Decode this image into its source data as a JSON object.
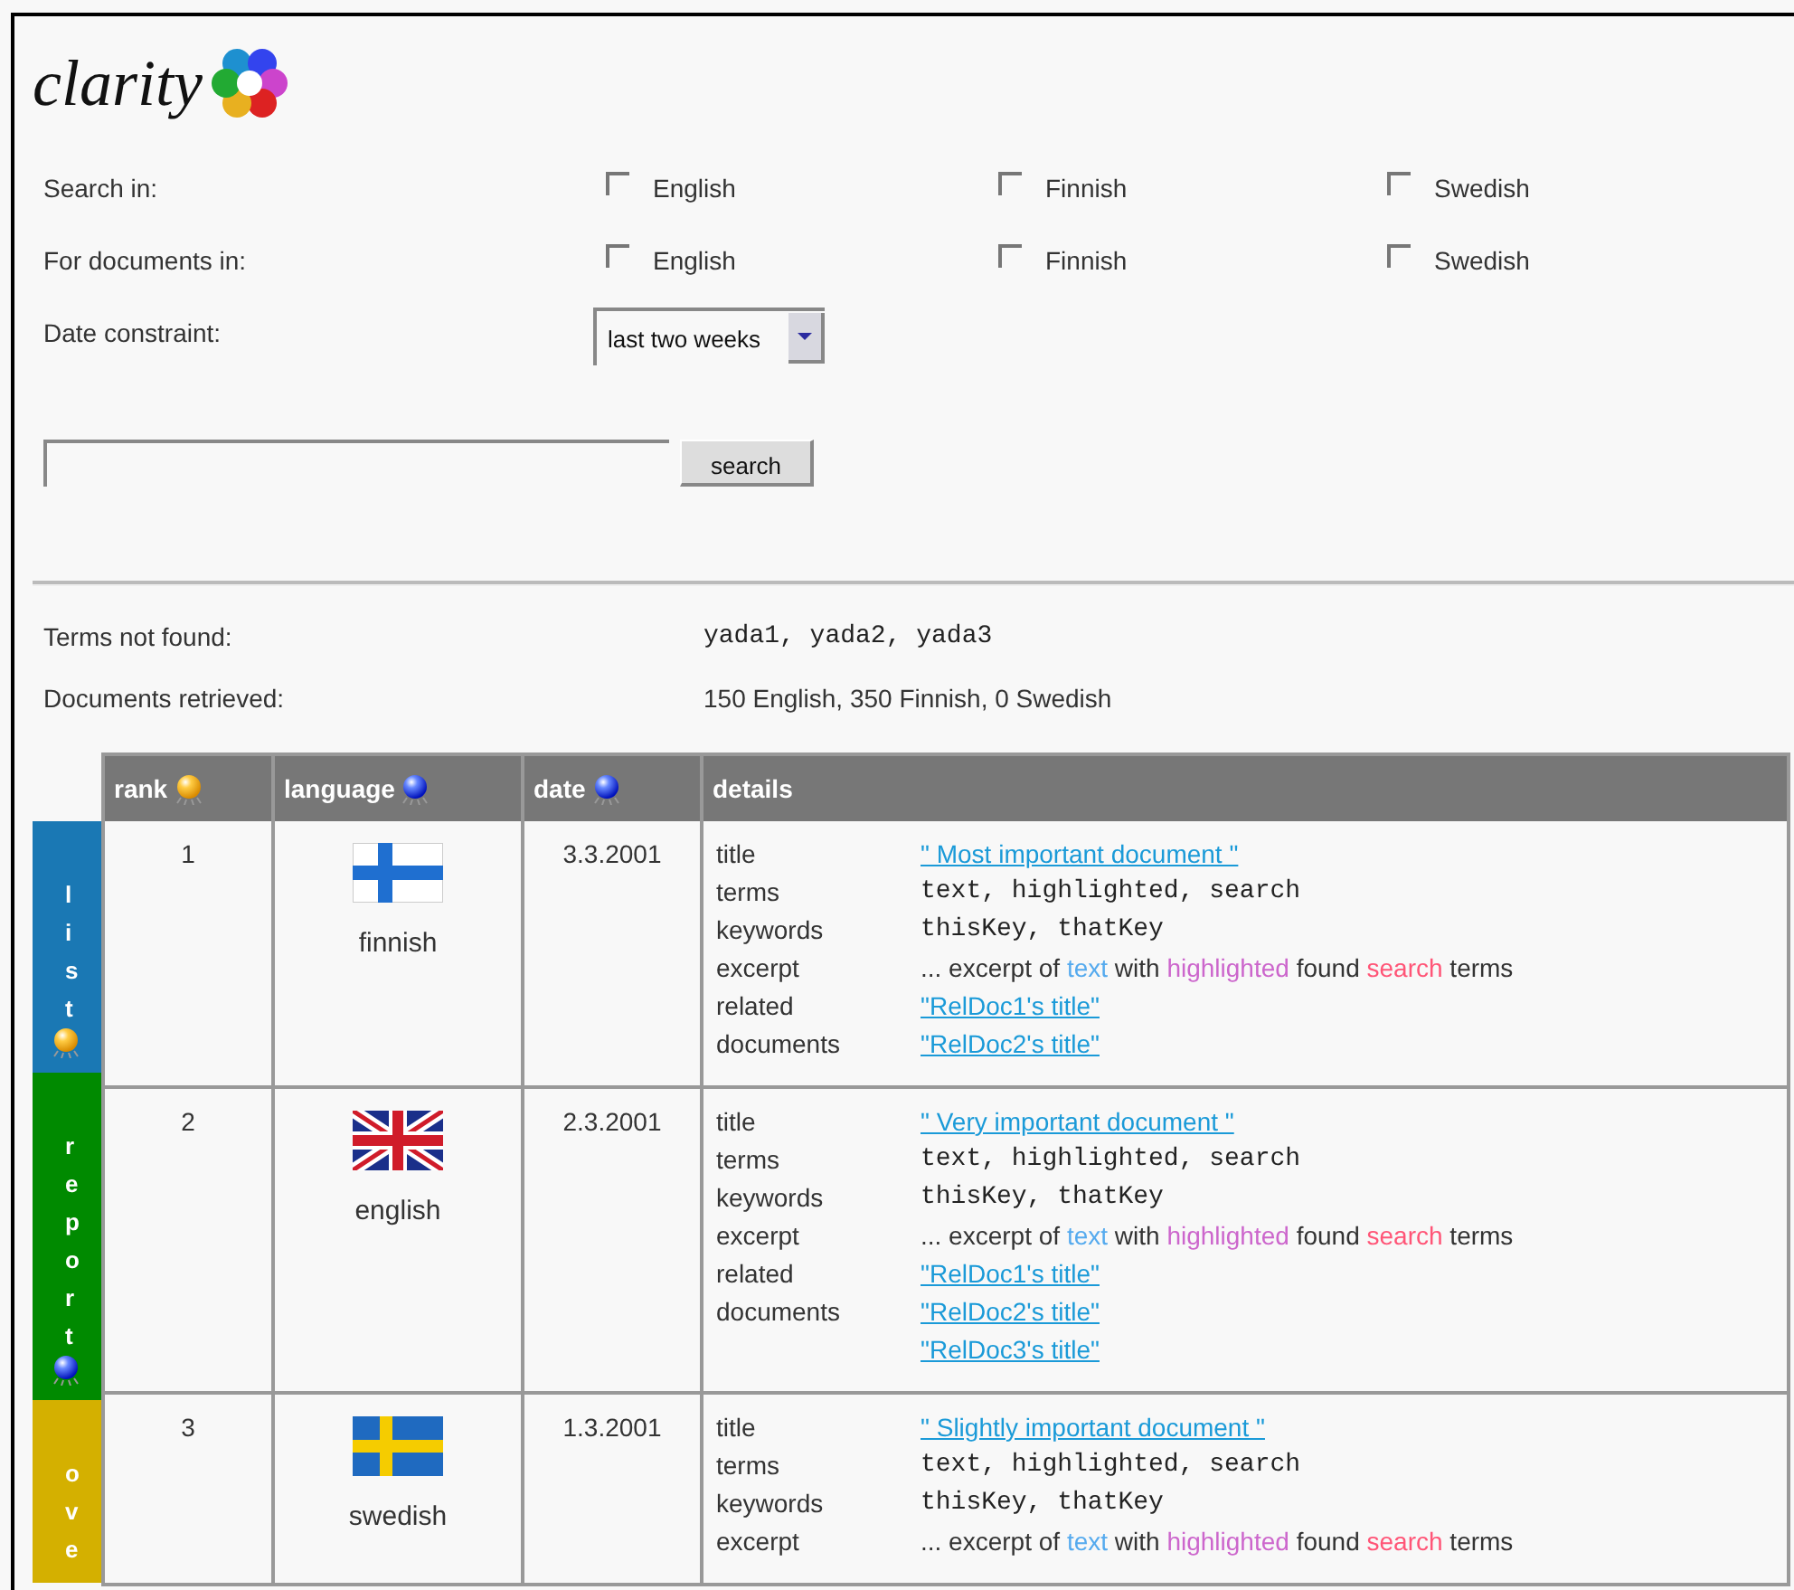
{
  "logo": {
    "text": "clarity"
  },
  "search_in": {
    "label": "Search in:",
    "options": [
      {
        "label": "English",
        "checked": false
      },
      {
        "label": "Finnish",
        "checked": false
      },
      {
        "label": "Swedish",
        "checked": false
      }
    ]
  },
  "documents_in": {
    "label": "For documents in:",
    "options": [
      {
        "label": "English",
        "checked": false
      },
      {
        "label": "Finnish",
        "checked": false
      },
      {
        "label": "Swedish",
        "checked": false
      }
    ]
  },
  "date_constraint": {
    "label": "Date constraint:",
    "value": "last two weeks"
  },
  "query": {
    "button": "search"
  },
  "summary": [
    {
      "label": "Terms not found:",
      "value": "yada1, yada2, yada3",
      "kind": "mono"
    },
    {
      "label": "Documents retrieved:",
      "value": "150 English, 350 Finnish, 0 Swedish",
      "kind": "plain"
    }
  ],
  "view_tabs": [
    {
      "label": "list",
      "color": "#1a78b4",
      "active": true
    },
    {
      "label": "report",
      "color": "#008a00",
      "active": false
    },
    {
      "label": "ove",
      "color": "#d4b000"
    }
  ],
  "table": {
    "columns": [
      {
        "label": "rank",
        "active": true
      },
      {
        "label": "language",
        "active": false
      },
      {
        "label": "date",
        "active": false
      },
      {
        "label": "details"
      }
    ],
    "rows": [
      {
        "rank": "1",
        "kind": "finland",
        "language": "finnish",
        "date": "3.3.2001",
        "details": [
          {
            "label": "title",
            "kind": "link",
            "value": "\" Most important document \""
          },
          {
            "label": "terms",
            "kind": "mono",
            "value": "text, highlighted, search"
          },
          {
            "label": "keywords",
            "kind": "mono",
            "value": "thisKey, thatKey"
          },
          {
            "label": "excerpt",
            "kind": "excerpt",
            "parts": [
              {
                "text": "... excerpt of "
              },
              {
                "text": "text",
                "color": "#55aaee"
              },
              {
                "text": " with "
              },
              {
                "text": "highlighted",
                "color": "#cc66cc"
              },
              {
                "text": " found "
              },
              {
                "text": "search",
                "color": "#ff5577"
              },
              {
                "text": " terms"
              }
            ]
          },
          {
            "label": "related documents",
            "kind": "links",
            "values": [
              "\"RelDoc1's title\"",
              "\"RelDoc2's title\""
            ]
          }
        ]
      },
      {
        "rank": "2",
        "kind": "uk",
        "language": "english",
        "date": "2.3.2001",
        "details": [
          {
            "label": "title",
            "kind": "link",
            "value": "\" Very important document \""
          },
          {
            "label": "terms",
            "kind": "mono",
            "value": "text, highlighted, search"
          },
          {
            "label": "keywords",
            "kind": "mono",
            "value": "thisKey, thatKey"
          },
          {
            "label": "excerpt",
            "kind": "excerpt",
            "parts": [
              {
                "text": "... excerpt of "
              },
              {
                "text": "text",
                "color": "#55aaee"
              },
              {
                "text": " with "
              },
              {
                "text": "highlighted",
                "color": "#cc66cc"
              },
              {
                "text": " found "
              },
              {
                "text": "search",
                "color": "#ff5577"
              },
              {
                "text": " terms"
              }
            ]
          },
          {
            "label": "related documents",
            "kind": "links",
            "values": [
              "\"RelDoc1's title\"",
              "\"RelDoc2's title\"",
              "\"RelDoc3's title\""
            ]
          }
        ]
      },
      {
        "rank": "3",
        "kind": "sweden",
        "language": "swedish",
        "date": "1.3.2001",
        "details": [
          {
            "label": "title",
            "kind": "link",
            "value": "\" Slightly important document \""
          },
          {
            "label": "terms",
            "kind": "mono",
            "value": "text, highlighted, search"
          },
          {
            "label": "keywords",
            "kind": "mono",
            "value": "thisKey, thatKey"
          },
          {
            "label": "excerpt",
            "kind": "excerpt",
            "parts": [
              {
                "text": "... excerpt of "
              },
              {
                "text": "text",
                "color": "#55aaee"
              },
              {
                "text": " with "
              },
              {
                "text": "highlighted",
                "color": "#cc66cc"
              },
              {
                "text": " found "
              },
              {
                "text": "search",
                "color": "#ff5577"
              },
              {
                "text": " terms"
              }
            ]
          }
        ]
      }
    ]
  }
}
